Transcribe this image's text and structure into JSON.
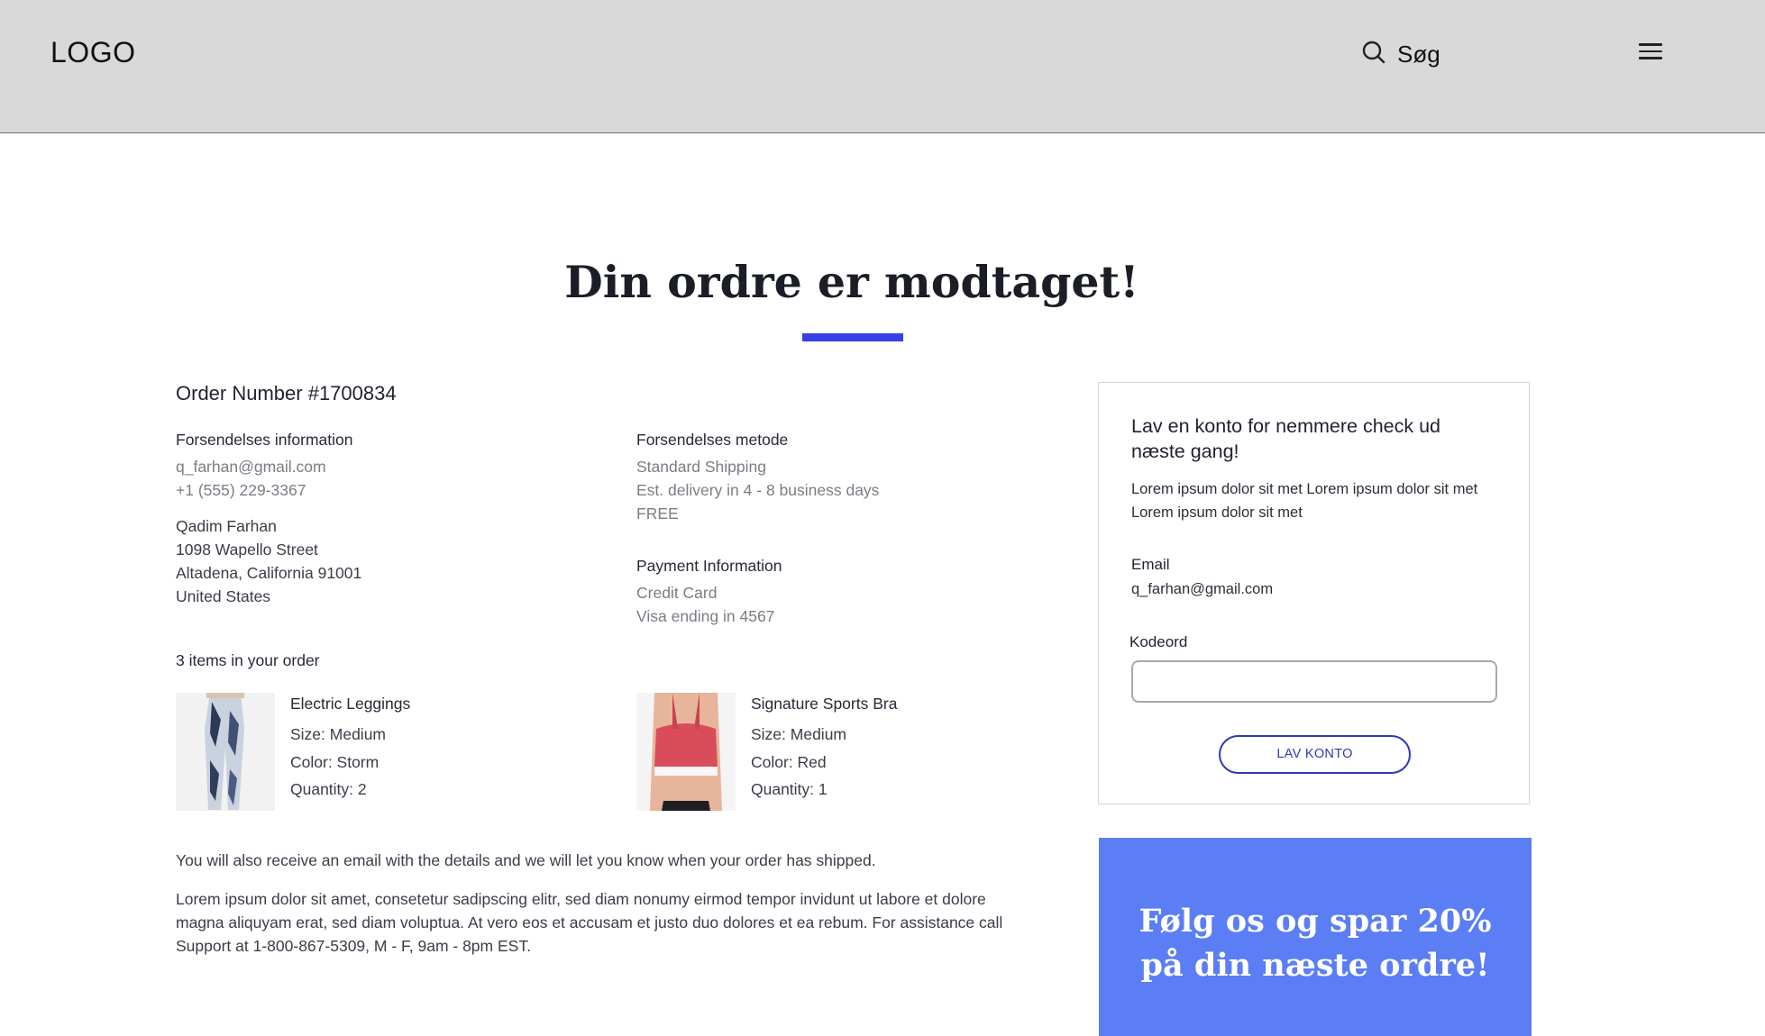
{
  "header": {
    "logo": "LOGO",
    "search_label": "Søg",
    "icons": {
      "search": "search-icon",
      "menu": "hamburger-menu-icon"
    },
    "background": "#d9d9d9"
  },
  "page": {
    "title": "Din ordre er modtaget!",
    "accent_color": "#3540e6"
  },
  "order": {
    "number": "Order Number #1700834",
    "shipping_info": {
      "label": "Forsendelses information",
      "email": "q_farhan@gmail.com",
      "phone": "+1 (555) 229-3367",
      "name": "Qadim Farhan",
      "street": "1098 Wapello Street",
      "city": "Altadena, California 91001",
      "country": "United States"
    },
    "shipping_method": {
      "label": "Forsendelses metode",
      "method": "Standard Shipping",
      "delivery": "Est. delivery in 4 - 8 business days",
      "price": "FREE"
    },
    "payment": {
      "label": "Payment Information",
      "method": "Credit Card",
      "card": "Visa ending in 4567"
    },
    "items_label": "3 items in your order",
    "items": [
      {
        "name": "Electric Leggings",
        "size": "Size: Medium",
        "color": "Color: Storm",
        "quantity": "Quantity: 2"
      },
      {
        "name": "Signature Sports Bra",
        "size": "Size: Medium",
        "color": "Color: Red",
        "quantity": "Quantity: 1"
      }
    ],
    "email_notice": "You will also receive an email with the details and we will let you know when your order has shipped.",
    "lorem_line1": "Lorem ipsum dolor sit amet, consetetur sadipscing elitr, sed diam nonumy eirmod tempor invidunt ut labore et dolore",
    "lorem_line2": "magna aliquyam erat, sed diam voluptua. At vero eos et accusam et justo duo dolores et ea rebum. For assistance call",
    "lorem_line3": "Support at 1-800-867-5309, M - F, 9am - 8pm EST."
  },
  "account": {
    "title": "Lav en konto for nemmere check ud næste gang!",
    "text": "Lorem ipsum dolor sit met Lorem ipsum dolor sit met Lorem ipsum dolor sit met",
    "email_label": "Email",
    "email_value": "q_farhan@gmail.com",
    "password_label": "Kodeord",
    "password_value": "",
    "button_label": "LAV KONTO",
    "button_color": "#2f39b8"
  },
  "promo": {
    "text": "Følg os og spar 20% på din næste ordre!",
    "background": "#5b7ef5"
  }
}
